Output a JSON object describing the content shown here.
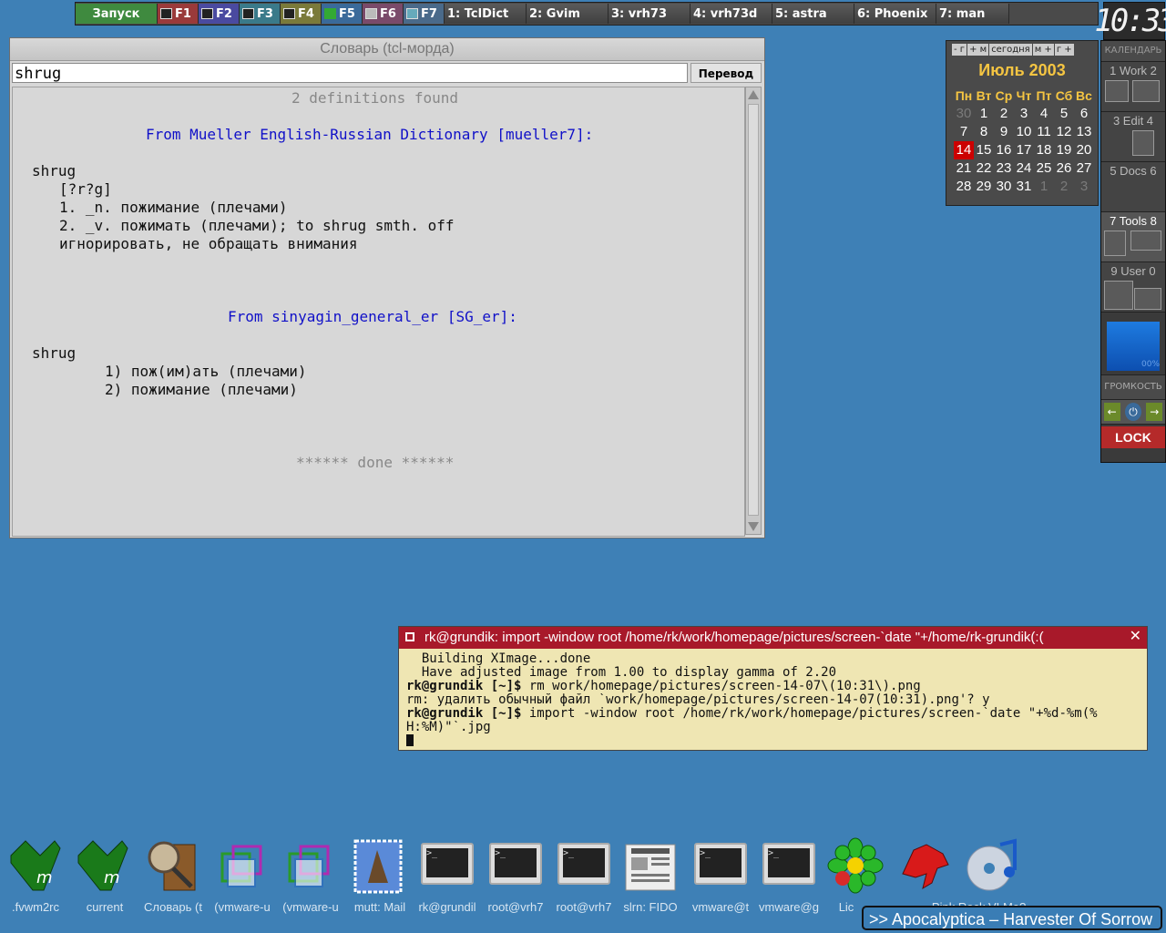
{
  "taskbar": {
    "start_label": "Запуск",
    "fkeys": [
      "F1",
      "F2",
      "F3",
      "F4",
      "F5",
      "F6",
      "F7"
    ],
    "fkey_colors": [
      "#9a3a3a",
      "#4a4aa0",
      "#3a7a8a",
      "#7a7a3a",
      "#3a6a9a",
      "#7a4a6a",
      "#4a6a8a"
    ],
    "tasks": [
      "1: TclDict",
      "2: Gvim",
      "3: vrh73",
      "4: vrh73d",
      "5: astra",
      "6: Phoenix",
      "7: man"
    ]
  },
  "clock": "10:33",
  "dict": {
    "title": "Словарь (tcl-морда)",
    "query": "shrug",
    "translate_button": "Перевод",
    "lines": {
      "found": "2 definitions found",
      "src1": "From Mueller English-Russian Dictionary [mueller7]:",
      "word1": "shrug",
      "pron": "[?r?g]",
      "def1": "1. _n. пожимание (плечами)",
      "def2": "2. _v. пожимать (плечами); to shrug smth. off",
      "def3": "игнорировать, не обращать внимания",
      "src2": "From sinyagin_general_er [SG_er]:",
      "word2": "shrug",
      "sg1": "1) пож(им)ать (плечами)",
      "sg2": "2) пожимание (плечами)",
      "done": "****** done ******"
    }
  },
  "calendar": {
    "nav": [
      "-",
      "г",
      "+",
      "м",
      "сегодня",
      "м",
      "+",
      "г",
      "+"
    ],
    "month": "Июль 2003",
    "days": [
      "Пн",
      "Вт",
      "Ср",
      "Чт",
      "Пт",
      "Сб",
      "Вс"
    ],
    "weeks": [
      [
        "30",
        "1",
        "2",
        "3",
        "4",
        "5",
        "6"
      ],
      [
        "7",
        "8",
        "9",
        "10",
        "11",
        "12",
        "13"
      ],
      [
        "14",
        "15",
        "16",
        "17",
        "18",
        "19",
        "20"
      ],
      [
        "21",
        "22",
        "23",
        "24",
        "25",
        "26",
        "27"
      ],
      [
        "28",
        "29",
        "30",
        "31",
        "1",
        "2",
        "3"
      ]
    ],
    "today": "14"
  },
  "panel": {
    "calendar_label": "КАЛЕНДАРЬ",
    "desks": [
      "1 Work 2",
      "3 Edit 4",
      "5 Docs 6",
      "7 Tools 8",
      "9 User 0"
    ],
    "active_desk": 3,
    "volume_label": "ГРОМКОСТЬ",
    "volume_value": "00%",
    "lock_label": "LOCK"
  },
  "xterm": {
    "title": "rk@grundik: import -window root /home/rk/work/homepage/pictures/screen-`date \"+/home/rk-grundik(:(",
    "lines": [
      {
        "text": "  Building XImage...done",
        "bold_prefix": ""
      },
      {
        "text": "  Have adjusted image from 1.00 to display gamma of 2.20",
        "bold_prefix": ""
      },
      {
        "bold_prefix": "rk@grundik [~]$",
        "text": " rm work/homepage/pictures/screen-14-07\\(10:31\\).png"
      },
      {
        "text": "rm: удалить обычный файл `work/homepage/pictures/screen-14-07(10:31).png'? y",
        "bold_prefix": ""
      },
      {
        "bold_prefix": "rk@grundik [~]$",
        "text": " import -window root /home/rk/work/homepage/pictures/screen-`date \"+%d-%m(%"
      },
      {
        "text": "H:%M)\"`.jpg",
        "bold_prefix": ""
      }
    ]
  },
  "dock": {
    "labels": [
      ".fvwm2rc",
      "current",
      "Словарь (t",
      "(vmware-u",
      "(vmware-u",
      "mutt: Mail",
      "rk@grundil",
      "root@vrh7",
      "root@vrh7",
      "slrn: FIDO",
      "vmware@t",
      "vmware@g",
      "Lic",
      "Pink Rock VLMe? .."
    ],
    "icons": [
      "vim-icon",
      "vim-icon",
      "dictionary-icon",
      "vmware-icon",
      "vmware-icon",
      "mail-stamp-icon",
      "terminal-icon",
      "terminal-icon",
      "terminal-icon",
      "newspaper-icon",
      "terminal-icon",
      "terminal-icon",
      "icq-flower-icon",
      "mozilla-lizard-icon",
      "music-cd-icon"
    ]
  },
  "now_playing": ">> Apocalyptica – Harvester Of Sorrow"
}
